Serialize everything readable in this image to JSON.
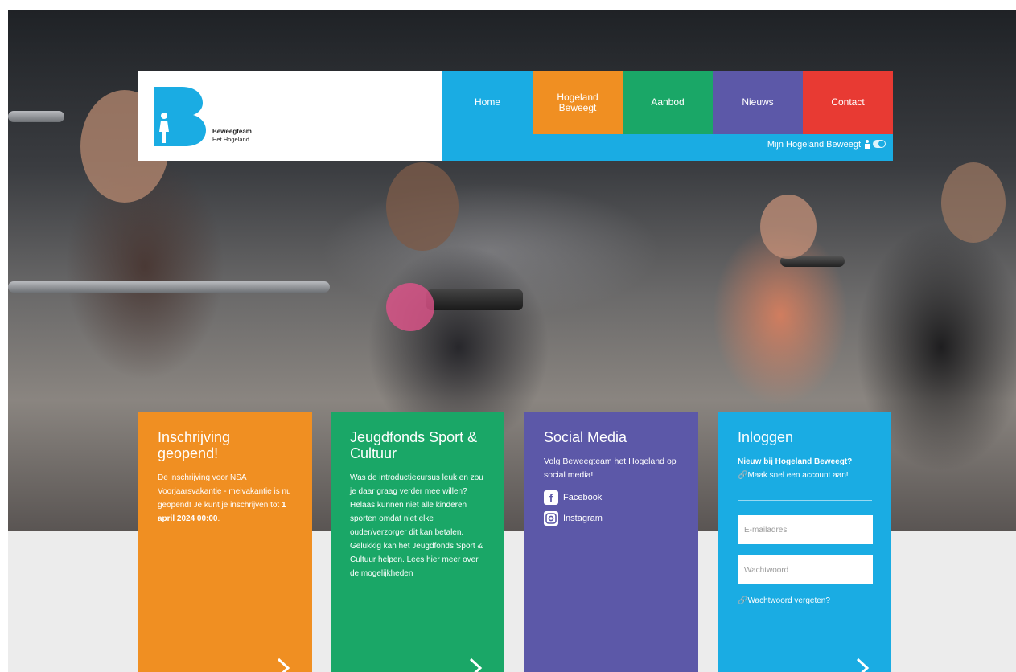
{
  "brand": {
    "logo_letter": "B",
    "name_line1": "Beweegteam",
    "name_line2": "Het Hogeland",
    "color": "#1aace3"
  },
  "nav": {
    "items": [
      {
        "label": "Home",
        "color": "#1aace3"
      },
      {
        "label": "Hogeland Beweegt",
        "color": "#f08f22"
      },
      {
        "label": "Aanbod",
        "color": "#1aa767"
      },
      {
        "label": "Nieuws",
        "color": "#5c58a8"
      },
      {
        "label": "Contact",
        "color": "#e83a33"
      }
    ],
    "sub_link": "Mijn Hogeland Beweegt"
  },
  "cards": {
    "inschrijving": {
      "title": "Inschrijving geopend!",
      "text": "De inschrijving voor NSA Voorjaarsvakantie - meivakantie is nu geopend! Je kunt je inschrijven tot ",
      "bold": "1 april 2024 00:00",
      "end": "."
    },
    "jeugdfonds": {
      "title": "Jeugdfonds Sport & Cultuur",
      "text": "Was de introductiecursus leuk en zou je daar graag verder mee willen? Helaas kunnen niet alle kinderen sporten omdat niet elke ouder/verzorger dit kan betalen. Gelukkig kan het Jeugdfonds Sport & Cultuur helpen. Lees hier meer over de mogelijkheden"
    },
    "social": {
      "title": "Social Media",
      "text": "Volg Beweegteam het Hogeland op social media!",
      "facebook": "Facebook",
      "instagram": "Instagram"
    },
    "login": {
      "title": "Inloggen",
      "new_label": "Nieuw bij Hogeland Beweegt?",
      "create_link": "Maak snel een account aan!",
      "email_placeholder": "E-mailadres",
      "password_placeholder": "Wachtwoord",
      "forgot_link": "Wachtwoord vergeten?"
    }
  }
}
